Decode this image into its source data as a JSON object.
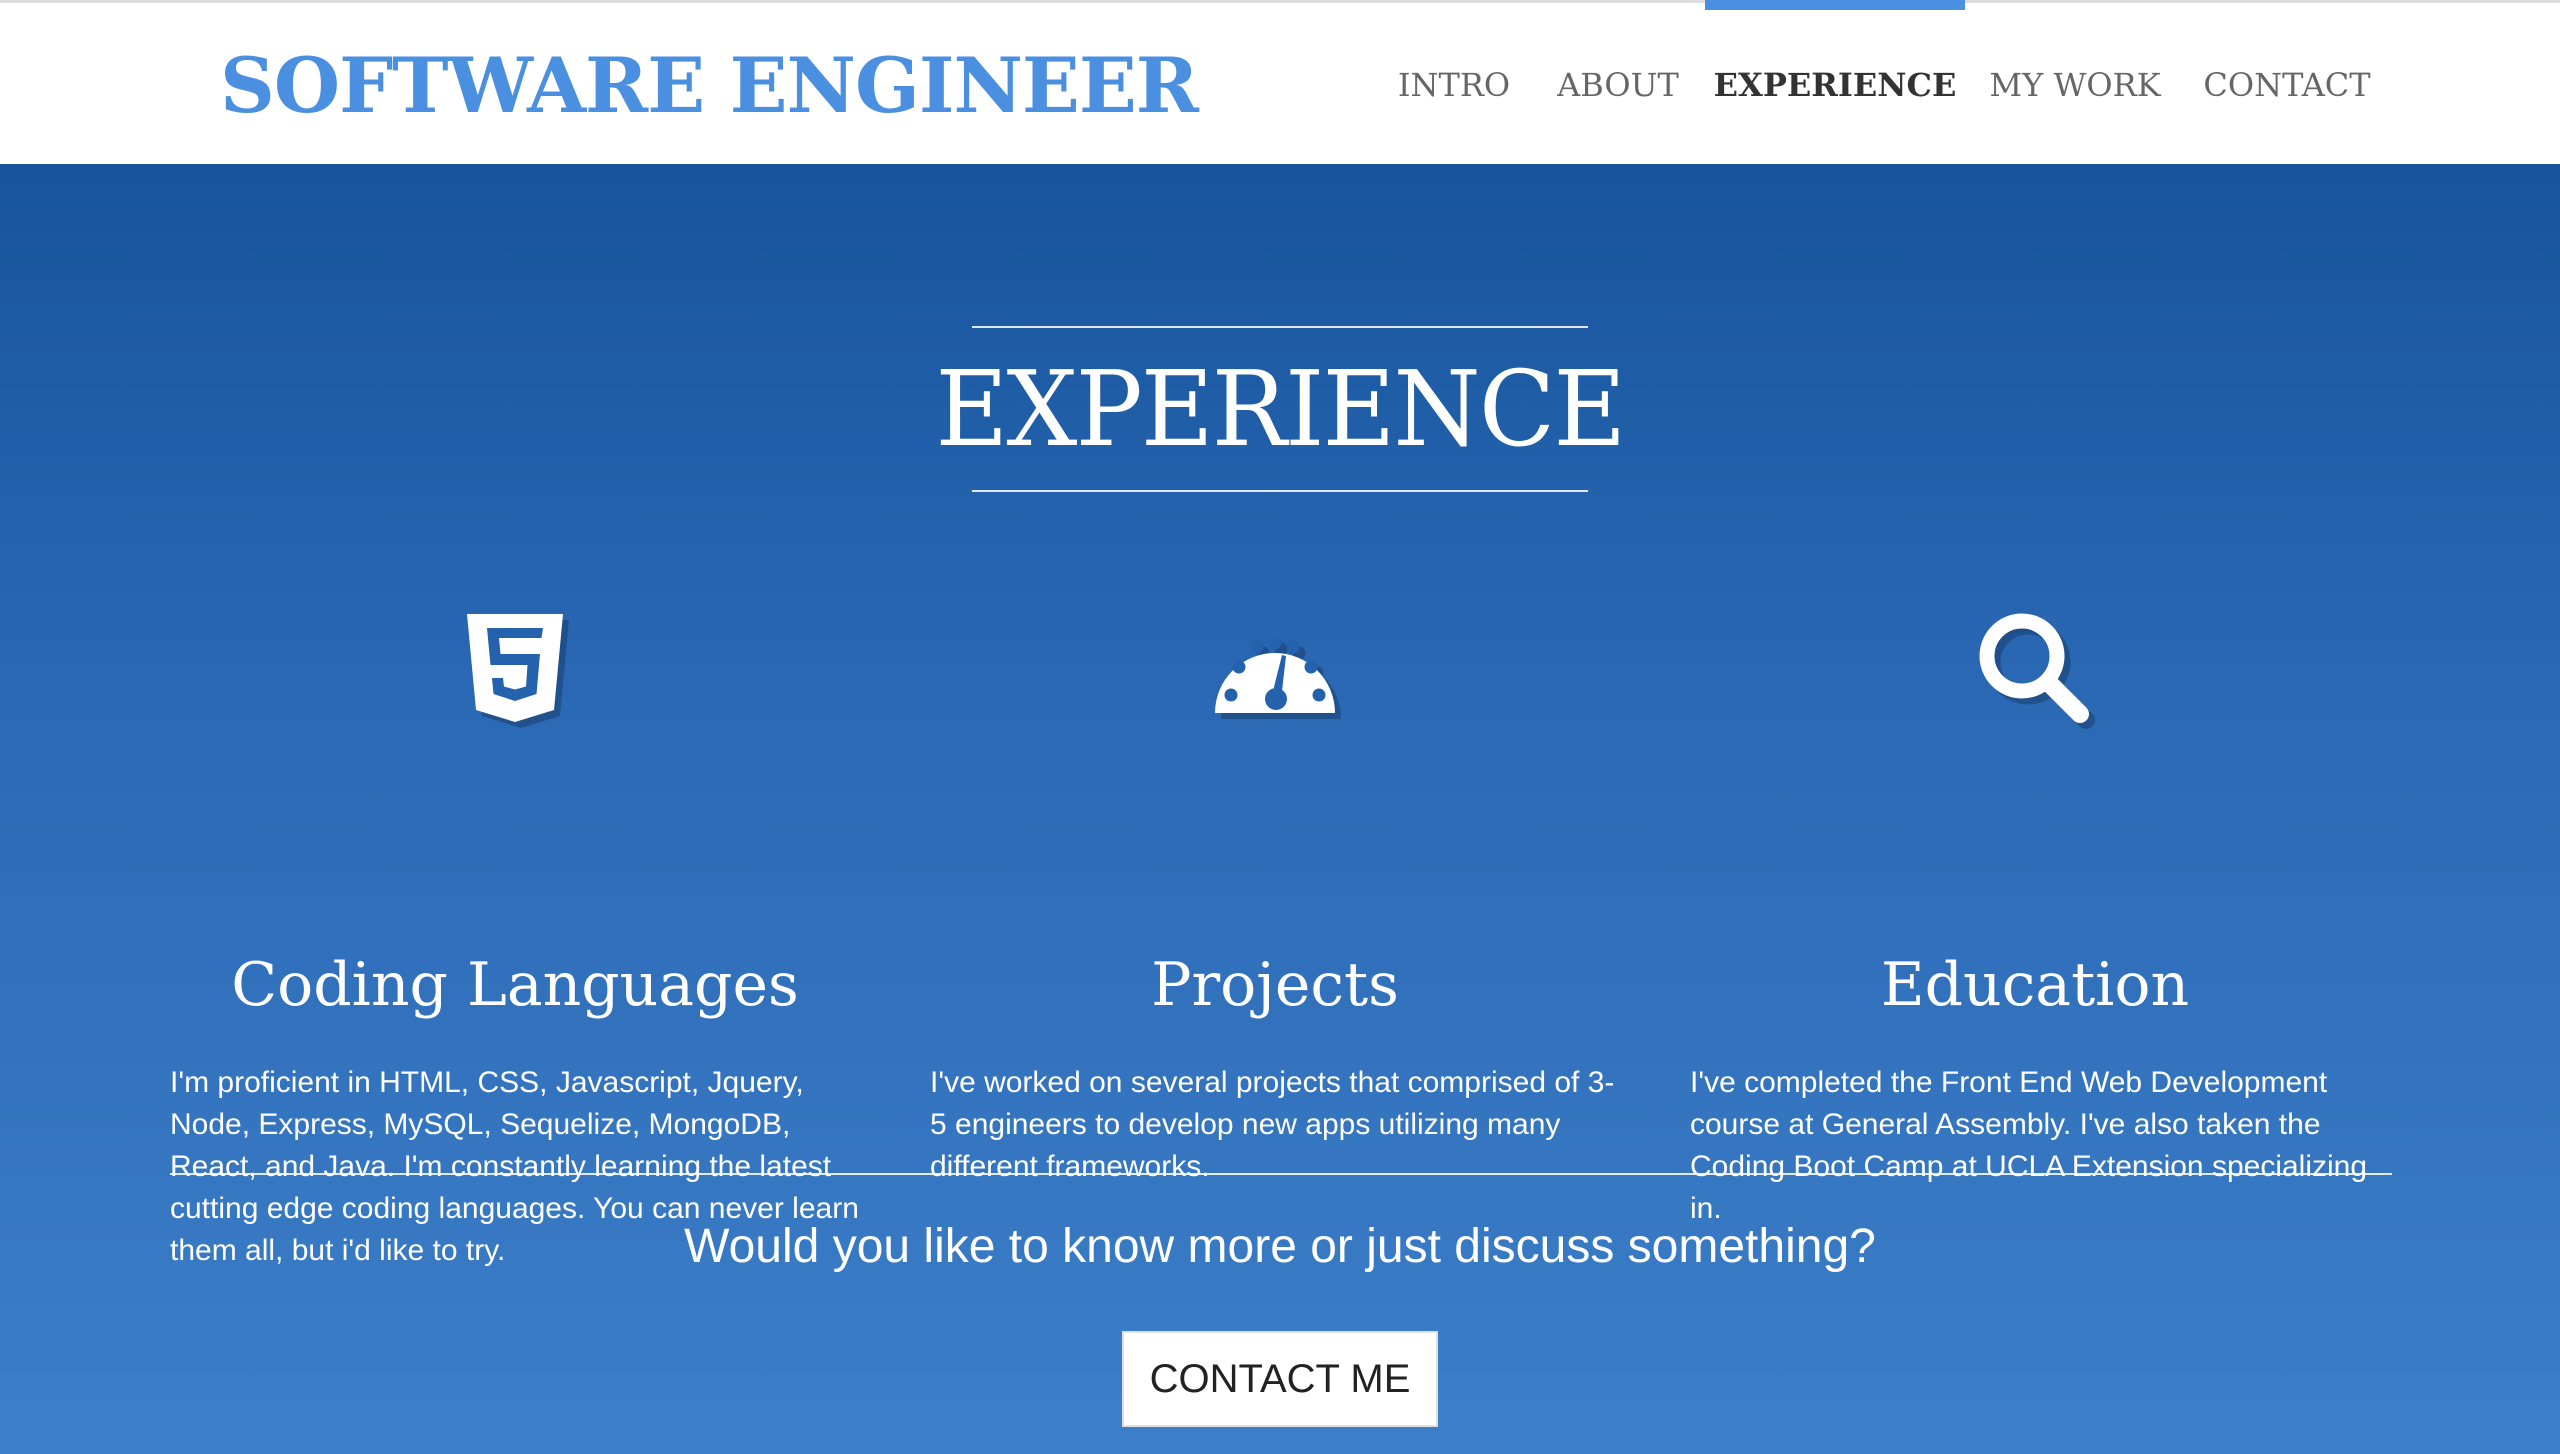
{
  "header": {
    "brand": "SOFTWARE ENGINEER",
    "nav": [
      {
        "label": "INTRO",
        "active": false
      },
      {
        "label": "ABOUT",
        "active": false
      },
      {
        "label": "EXPERIENCE",
        "active": true
      },
      {
        "label": "MY WORK",
        "active": false
      },
      {
        "label": "CONTACT",
        "active": false
      }
    ]
  },
  "section": {
    "heading": "EXPERIENCE",
    "columns": [
      {
        "icon": "html5-icon",
        "title": "Coding Languages",
        "text": "I'm proficient in HTML, CSS, Javascript, Jquery, Node, Express, MySQL, Sequelize, MongoDB, React, and Java. I'm constantly learning the latest cutting edge coding languages. You can never learn them all, but i'd like to try."
      },
      {
        "icon": "dashboard-icon",
        "title": "Projects",
        "text": "I've worked on several projects that comprised of 3-5 engineers to develop new apps utilizing many different frameworks."
      },
      {
        "icon": "search-icon",
        "title": "Education",
        "text": "I've completed the Front End Web Development course at General Assembly. I've also taken the Coding Boot Camp at UCLA Extension specializing in."
      }
    ],
    "cta_question": "Would you like to know more or just discuss something?",
    "cta_button": "CONTACT ME"
  },
  "colors": {
    "brand": "#4a8fe0",
    "section_top": "#17549c",
    "section_bottom": "#3d7fc9",
    "active_nav": "#333333",
    "nav": "#666666"
  }
}
